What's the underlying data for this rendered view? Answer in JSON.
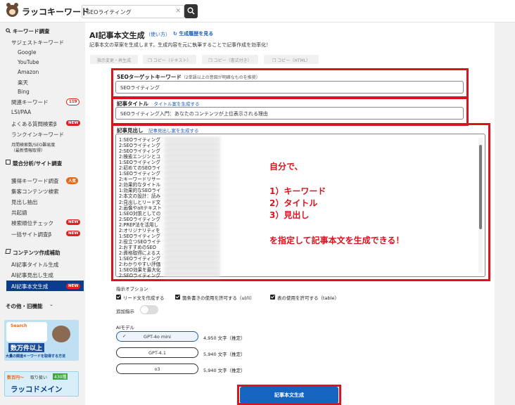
{
  "header": {
    "logo_text": "ラッコキーワード",
    "search_value": "SEOライティング",
    "clear_glyph": "✕"
  },
  "sidebar": {
    "kw_head": "キーワード調査",
    "suggest": "サジェストキーワード",
    "engines": [
      "Google",
      "YouTube",
      "Amazon",
      "楽天",
      "Bing"
    ],
    "related": "関連キーワード",
    "related_count": "119",
    "lsi": "LSI/PAA",
    "faq": "よくある質問検索β",
    "faq_badge": "NEW",
    "rankin": "ランクインキーワード",
    "monthly1": "月間検索数/SEO難易度",
    "monthly2": "（最新情報取得）",
    "comp_head": "競合分析/サイト調査",
    "acquired": "獲得キーワード調査",
    "acquired_badge": "人気",
    "traffic": "集客コンテンツ検索",
    "heading_extract": "見出し抽出",
    "cooccur": "共起語",
    "rank_check": "検索順位チェック",
    "rank_badge": "NEW",
    "bulk": "一括サイト調査β",
    "bulk_badge": "NEW",
    "content_head": "コンテンツ作成補助",
    "ai_title": "AI記事タイトル生成",
    "ai_heading": "AI記事見出し生成",
    "ai_body": "AI記事本文生成",
    "ai_body_badge": "NEW",
    "other_head": "その他・旧機能",
    "banner1_top": "Search",
    "banner1_mid": "数万件以上",
    "banner1_bottom": "大量の関連キーワードを取得する方法",
    "banner2_left": "数百円〜",
    "banner2_mid": "取り扱い",
    "banner2_count": "430種",
    "banner2_bottom": "ラッコドメイン"
  },
  "main": {
    "title": "AI記事本文生成",
    "usage": "（使い方）",
    "history": "生成履歴を見る",
    "desc": "記事本文の草案を生成します。生成内容を元に執筆することで記事作成を効率化！",
    "toolbar": [
      "指示変更・再生成",
      "コピー（テキスト）",
      "コピー（書式付き）",
      "コピー（HTML）"
    ],
    "kw_label": "SEOターゲットキーワード",
    "kw_sub": "（2単語以上の意図が明確なものを推奨）",
    "kw_value": "SEOライティング",
    "title_label": "記事タイトル",
    "title_link": "タイトル案を生成する",
    "title_value": "SEOライティング入門：あなたのコンテンツが上位表示される理由",
    "heading_label": "記事見出し",
    "heading_link": "記事見出し案を生成する",
    "heading_lines": [
      "1:SEOライティング",
      "2:SEOライティング",
      "2:SEOライティング",
      "2:検索エンジンとユ",
      "1:SEOライティング",
      "2:初めてのSEOライ",
      "1:SEOライティング",
      "2:キーワードリサー",
      "2:効果的なタイトル",
      "1:効果的なSEOライ",
      "2:本文の設計：読み",
      "2:見出しとリード文",
      "2:画像やaltテキスト",
      "1:SEO対策としての",
      "2:SEOライティング",
      "2:PREP法を活用し",
      "2:オリジナリティを",
      "1:SEOライティング",
      "2:役立つSEOライテ",
      "2:おすすめのSEO",
      "2:資格取得によるス",
      "1:SEOライティング",
      "2:わかりやすい評価",
      "1:SEO効果を最大化",
      "2:SEOライティング"
    ],
    "ann_line1": "自分で、",
    "ann_items": [
      "1）キーワード",
      "2）タイトル",
      "3）見出し"
    ],
    "ann_line2": "を指定して記事本文を生成できる！",
    "options_label": "指示オプション",
    "opt1": "リード文を作成する",
    "opt2": "箇条書きの使用を許可する（ul/li）",
    "opt3": "表の使用を許可する（table）",
    "extra": "追加指示",
    "ai_model_label": "AIモデル",
    "models": [
      {
        "name": "GPT-4o mini",
        "count": "4,950 文字（推定）"
      },
      {
        "name": "GPT-4.1",
        "count": "5,940 文字（推定）"
      },
      {
        "name": "o3",
        "count": "5,940 文字（推定）"
      }
    ],
    "check": "✓",
    "generate": "記事本文生成"
  },
  "colors": {
    "red": "#d8141e",
    "navy": "#0b3d8c",
    "link": "#1a5dc8"
  }
}
